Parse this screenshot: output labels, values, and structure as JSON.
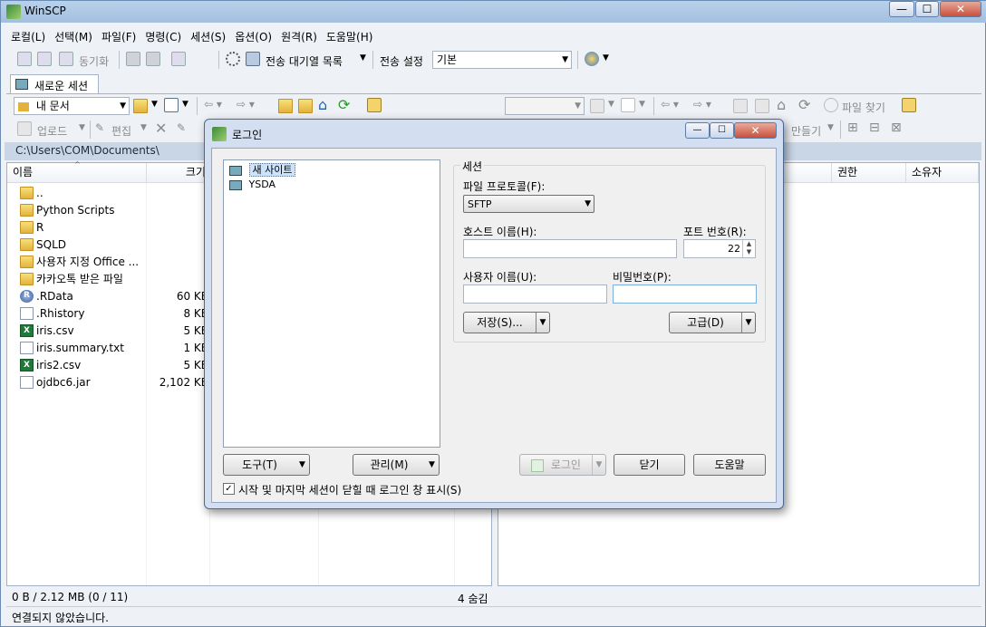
{
  "app": {
    "title": "WinSCP",
    "window_buttons": {
      "minimize": "—",
      "maximize": "☐",
      "close": "✕"
    }
  },
  "menu": [
    "로컬(L)",
    "선택(M)",
    "파일(F)",
    "명령(C)",
    "세션(S)",
    "옵션(O)",
    "원격(R)",
    "도움말(H)"
  ],
  "toolbar1": {
    "sync_label": "동기화",
    "queue_label": "전송 대기열 목록",
    "transfer_settings_label": "전송 설정",
    "transfer_settings_value": "기본"
  },
  "tabs": {
    "new_session": "새로운 세션"
  },
  "local_toolbar": {
    "location_value": "내 문서",
    "upload_label": "업로드",
    "edit_label": "편집"
  },
  "remote_toolbar": {
    "find_files_label": "파일 찾기",
    "new_label": "만들기"
  },
  "local_panel": {
    "path": "C:\\Users\\COM\\Documents\\",
    "columns": {
      "name": "이름",
      "size": "크기"
    },
    "files": [
      {
        "name": "..",
        "size": "",
        "icon": "parent-dir-icon"
      },
      {
        "name": "Python Scripts",
        "size": "",
        "icon": "folder-icon"
      },
      {
        "name": "R",
        "size": "",
        "icon": "folder-icon"
      },
      {
        "name": "SQLD",
        "size": "",
        "icon": "folder-icon"
      },
      {
        "name": "사용자 지정 Office ...",
        "size": "",
        "icon": "folder-icon"
      },
      {
        "name": "카카오톡 받은 파일",
        "size": "",
        "icon": "folder-icon"
      },
      {
        "name": ".RData",
        "size": "60 KB",
        "icon": "r-data-icon"
      },
      {
        "name": ".Rhistory",
        "size": "8 KB",
        "icon": "file-icon"
      },
      {
        "name": "iris.csv",
        "size": "5 KB",
        "icon": "excel-icon"
      },
      {
        "name": "iris.summary.txt",
        "size": "1 KB",
        "icon": "file-icon"
      },
      {
        "name": "iris2.csv",
        "size": "5 KB",
        "icon": "excel-icon"
      },
      {
        "name": "ojdbc6.jar",
        "size": "2,102 KB",
        "icon": "file-icon"
      }
    ],
    "status": "0 B / 2.12 MB (0 / 11)",
    "hidden": "4 숨김"
  },
  "remote_panel": {
    "columns": {
      "permissions": "권한",
      "owner": "소유자"
    }
  },
  "status_bar": {
    "connection": "연결되지 않았습니다."
  },
  "login_dialog": {
    "title": "로그인",
    "sites": [
      {
        "name": "새 사이트",
        "selected": true
      },
      {
        "name": "YSDA",
        "selected": false
      }
    ],
    "session_group": "세션",
    "protocol_label": "파일 프로토콜(F):",
    "protocol_value": "SFTP",
    "host_label": "호스트 이름(H):",
    "host_value": "",
    "port_label": "포트 번호(R):",
    "port_value": "22",
    "user_label": "사용자 이름(U):",
    "user_value": "",
    "password_label": "비밀번호(P):",
    "password_value": "",
    "save_button": "저장(S)...",
    "advanced_button": "고급(D)",
    "tools_button": "도구(T)",
    "manage_button": "관리(M)",
    "login_button": "로그인",
    "close_button": "닫기",
    "help_button": "도움말",
    "show_on_startup_label": "시작 및 마지막 세션이 닫힐 때 로그인 창 표시(S)",
    "show_on_startup_checked": true
  },
  "colors": {
    "title_bar": "#b9d1ea",
    "window_bg": "#eef1f6",
    "selection": "#cde3fb",
    "path_bar": "#c9d6e6"
  }
}
